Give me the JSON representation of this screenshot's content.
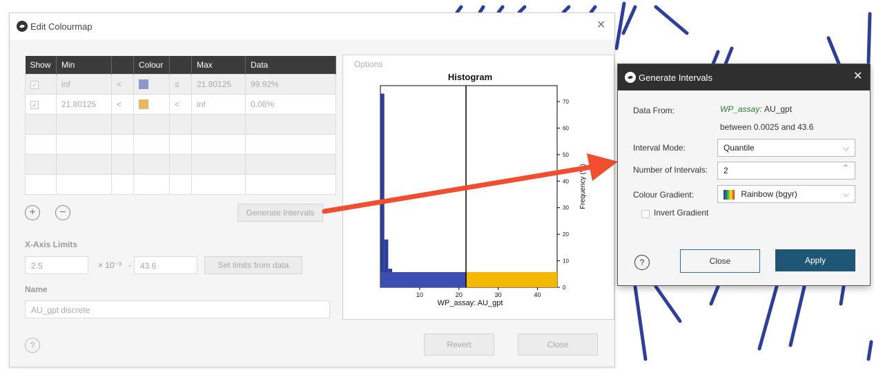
{
  "colours": {
    "band1": "#6b7bbd",
    "band2": "#f5b800",
    "swatch1": "#8d97cf",
    "swatch2": "#e6b864",
    "arrow": "#f04e2f",
    "accent": "#19557a",
    "tubes": "#2c3f9c"
  },
  "colourmap_dialog": {
    "title": "Edit Colourmap",
    "table": {
      "headers": [
        "Show",
        "Min",
        "",
        "Colour",
        "",
        "Max",
        "Data"
      ],
      "rows": [
        {
          "show": "✓",
          "min": "inf",
          "op1": "<",
          "op2": "≤",
          "max": "21.80125",
          "data": "99.92%"
        },
        {
          "show": "✓",
          "min": "21.80125",
          "op1": "<",
          "op2": "<",
          "max": "inf",
          "data": "0.08%"
        }
      ]
    },
    "add_symbol": "+",
    "remove_symbol": "−",
    "generate_intervals_label": "Generate Intervals",
    "x_axis_limits_label": "X-Axis Limits",
    "min_value": "2.5",
    "exponent_label": "× 10⁻³",
    "dash": "-",
    "max_value": "43.6",
    "set_limits_label": "Set limits from data",
    "name_label": "Name",
    "name_value": "AU_gpt discrete",
    "help_symbol": "?",
    "revert_label": "Revert",
    "close_label": "Close",
    "options_label": "Options"
  },
  "chart_data": {
    "type": "bar",
    "title": "Histogram",
    "xlabel": "WP_assay: AU_gpt",
    "ylabel": "Frequency (%)",
    "x": [
      0.5,
      1.5,
      2.5,
      3.5,
      4.5,
      5.5,
      6.5,
      7.5,
      8.5,
      9.5,
      10.5,
      11.5,
      12.5,
      13.5,
      14.5,
      15.5,
      16.5,
      17.5,
      18.5,
      19.5,
      20.5,
      21.5
    ],
    "values": [
      73,
      18,
      7,
      4,
      2.5,
      1.5,
      1.2,
      1.0,
      0.8,
      0.6,
      0.6,
      0.5,
      0.4,
      0.4,
      0.3,
      0.3,
      0.3,
      0.2,
      0.2,
      0.2,
      0.1,
      0.1
    ],
    "xlim": [
      0,
      45
    ],
    "ylim": [
      0,
      76
    ],
    "xticks": [
      "10",
      "20",
      "30",
      "40"
    ],
    "yticks": [
      "0",
      "10",
      "20",
      "30",
      "40",
      "50",
      "60",
      "70"
    ],
    "boundaries": [
      0,
      21.80125,
      45
    ],
    "divider": 21.80125,
    "grid": false
  },
  "gi_dialog": {
    "title": "Generate Intervals",
    "data_from_label": "Data From:",
    "data_from_source": "WP_assay:",
    "data_from_column": "AU_gpt",
    "range_text": "between 0.0025 and 43.6",
    "interval_mode_label": "Interval Mode:",
    "interval_mode_value": "Quantile",
    "number_label": "Number of Intervals:",
    "number_value": "2",
    "gradient_label": "Colour Gradient:",
    "gradient_value": "Rainbow (bgyr)",
    "invert_label": "Invert Gradient",
    "help_symbol": "?",
    "close_label": "Close",
    "apply_label": "Apply"
  }
}
